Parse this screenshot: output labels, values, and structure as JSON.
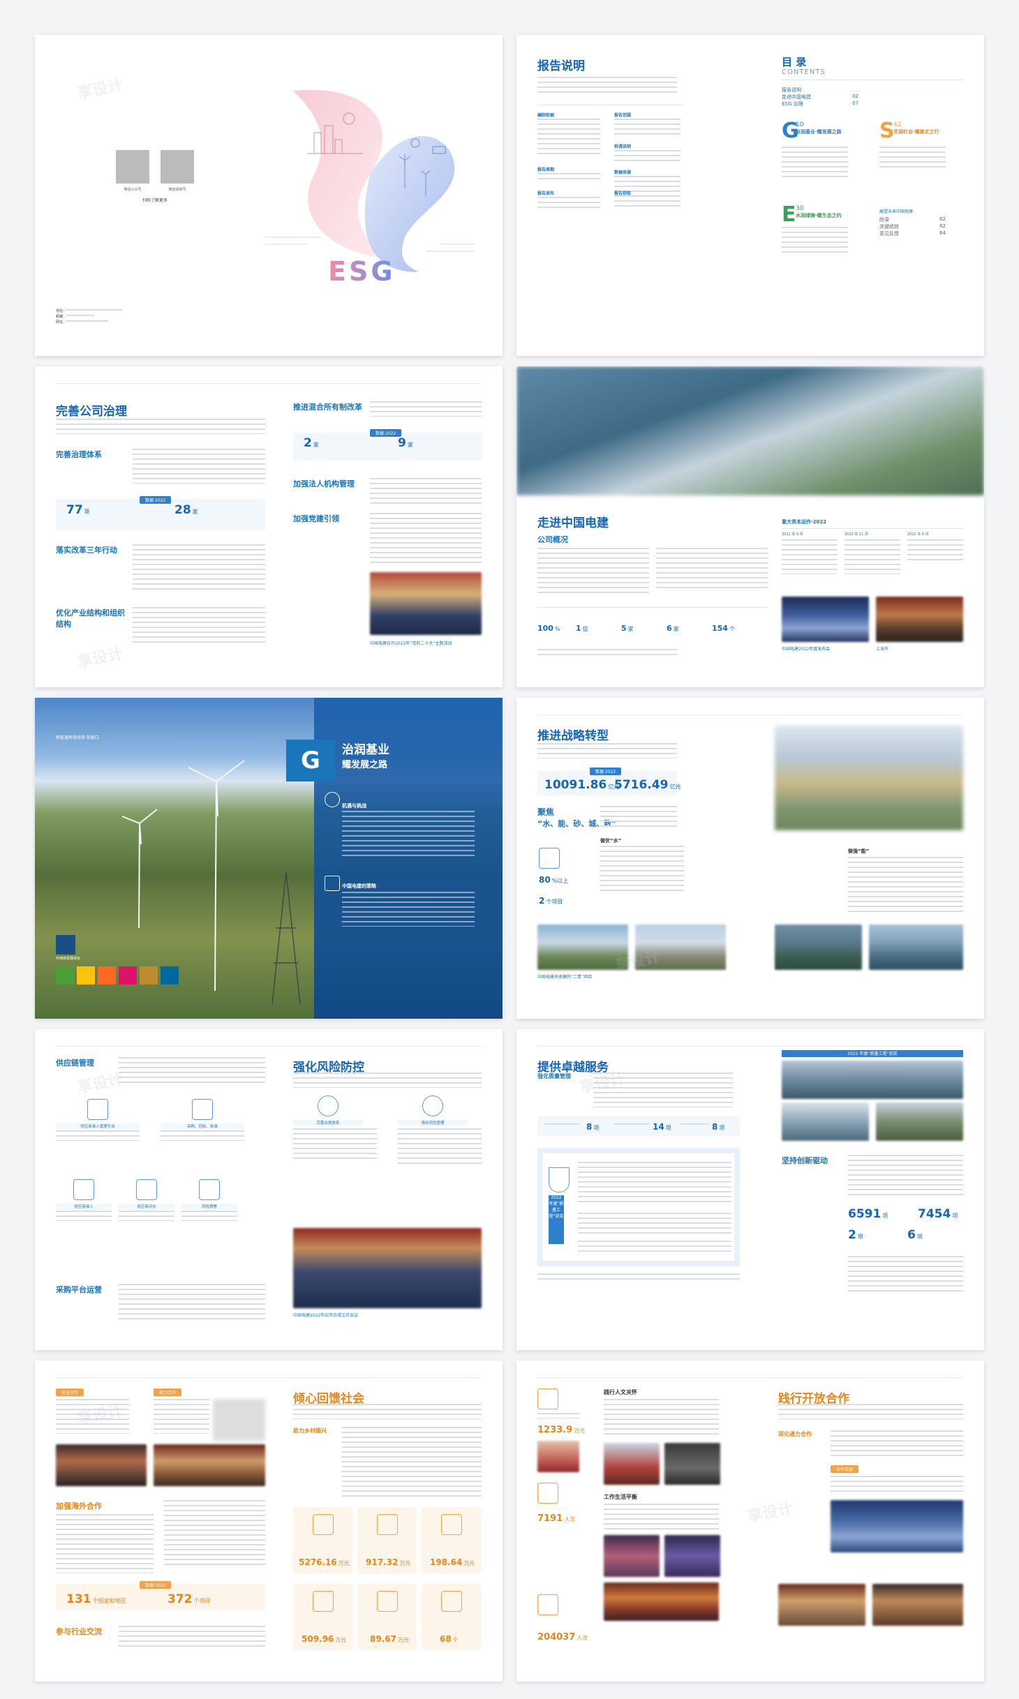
{
  "cover": {
    "qr_label_1": "微信公众号",
    "qr_label_2": "微信视频号",
    "qr_caption": "扫码了解更多",
    "address_label": "地址：",
    "postal_label": "邮编：",
    "web_label": "网址：",
    "logo_text": "ESG"
  },
  "report_intro": {
    "title": "报告说明",
    "items": [
      "编制依据",
      "报告范围",
      "称谓说明",
      "数据来源",
      "报告周期",
      "报告发布",
      "报告获取"
    ]
  },
  "contents": {
    "title": "目 录",
    "title_en": "CONTENTS",
    "front": [
      {
        "label": "报告说明",
        "page": ""
      },
      {
        "label": "走进中国电建",
        "page": "02"
      },
      {
        "label": "ESG 治理",
        "page": "07"
      }
    ],
    "sections": [
      {
        "letter": "G",
        "num": "10",
        "label": "治润基业·耀发展之路",
        "color": "#2a7fd4"
      },
      {
        "letter": "S",
        "num": "42",
        "label": "至润社会·耀美丈之行",
        "color": "#f2a33c"
      },
      {
        "letter": "E",
        "num": "30",
        "label": "水润绿铸·耀生态之约",
        "color": "#3aa05a"
      }
    ],
    "back_title": "展望未来中国电建",
    "back_items": [
      {
        "label": "附录",
        "page": "62"
      },
      {
        "label": "关键绩效",
        "page": "62"
      },
      {
        "label": "意见反馈",
        "page": "64"
      }
    ]
  },
  "governance": {
    "title": "完善公司治理",
    "sub1": "完善治理体系",
    "sub2": "落实改革三年行动",
    "sub3": "优化产业结构和组织结构",
    "badge": "数据·2022",
    "stat1_value": "77",
    "stat1_unit": "项",
    "stat2_value": "28",
    "stat2_unit": "家",
    "right_sub1": "推进混合所有制改革",
    "right_sub2": "加强法人机构管理",
    "right_sub3": "加强党建引领",
    "stat3_value": "2",
    "stat3_unit": "家",
    "stat4_value": "9",
    "stat4_unit": "家",
    "caption": "中国电建召开2022年“党的二十大”主题活动"
  },
  "about": {
    "title": "走进中国电建",
    "sub": "公司概况",
    "events_title": "重大资本运作·2022",
    "event_dates": [
      "2022 年 9 月",
      "2022 年 11 月",
      "2022 年 6 月"
    ],
    "stats": [
      {
        "value": "100",
        "unit": "%"
      },
      {
        "value": "1",
        "unit": "位"
      },
      {
        "value": "5",
        "unit": "家"
      },
      {
        "value": "6",
        "unit": "家"
      },
      {
        "value": "154",
        "unit": "个"
      }
    ],
    "caption_left": "中国电建2022年度发布会",
    "caption_right": "上海市"
  },
  "g_section": {
    "letter": "G",
    "title_line1": "治润基业",
    "title_line2": "耀发展之路",
    "sub1": "机遇与挑战",
    "sub2": "中国电建的策略",
    "sdg_label": "可持续发展目标",
    "photo_caption": "新能源风电项目·张家口"
  },
  "strategy": {
    "title": "推进战略转型",
    "badge": "数据·2022",
    "stat1_value": "10091.86",
    "stat1_unit": "亿元",
    "stat2_value": "5716.49",
    "stat2_unit": "亿元",
    "focus_title": "聚焦",
    "focus_sub": "“水、能、砂、城、数”",
    "water_label": "做优“水”",
    "stat3_value": "80",
    "stat3_unit": "%以上",
    "stat4_value": "2",
    "stat4_unit": "个项目",
    "energy_label": "做强“能”",
    "caption_bottom": "中国电建总承建的“二青”项目"
  },
  "supply": {
    "sub1": "供应链管理",
    "icon_labels": [
      "供应商准入管理平台",
      "采购、招标、标准",
      "供应商准入",
      "供应商评价",
      "风险预警"
    ],
    "sub2": "采购平台运营",
    "title_right": "强化风险防控",
    "icon2_labels": [
      "完善合规体系",
      "强化风险管理"
    ],
    "caption": "中国电建2022年召开合规工作会议"
  },
  "service": {
    "title": "提供卓越服务",
    "sub1": "强化质量管理",
    "stat1_value": "8",
    "stat1_unit": "项",
    "stat2_value": "14",
    "stat2_unit": "项",
    "stat3_value": "8",
    "stat3_unit": "项",
    "award_title": "2022 年度“质量工程”获奖",
    "sub2": "坚持创新驱动",
    "stat4_value": "6591",
    "stat4_unit": "项",
    "stat5_value": "7454",
    "stat5_unit": "项",
    "stat6_value": "2",
    "stat6_unit": "项",
    "stat7_value": "6",
    "stat7_unit": "项"
  },
  "social": {
    "tag1": "安全合作",
    "tag2": "能力合作",
    "sub1": "加强海外合作",
    "badge": "数据·2022",
    "stat1_value": "131",
    "stat1_unit": "个国家和地区",
    "stat2_value": "372",
    "stat2_unit": "个项目",
    "sub2": "参与行业交流",
    "title_right": "倾心回馈社会",
    "sub3": "助力乡村振兴",
    "icon_stats": [
      {
        "value": "5276.16",
        "unit": "万元"
      },
      {
        "value": "917.32",
        "unit": "万元"
      },
      {
        "value": "198.64",
        "unit": "万元"
      },
      {
        "value": "509.96",
        "unit": "万元"
      },
      {
        "value": "89.67",
        "unit": "万元"
      },
      {
        "value": "68",
        "unit": "个"
      }
    ]
  },
  "people": {
    "sub1": "践行人文关怀",
    "stat1_value": "1233.9",
    "stat1_unit": "万元",
    "stat2_value": "7191",
    "stat2_unit": "人次",
    "sub2": "工作生活平衡",
    "stat3_value": "204037",
    "stat3_unit": "人次",
    "title_right": "践行开放合作",
    "sub3": "深化通力合作",
    "tag": "合作交流"
  },
  "watermark": "享设计"
}
